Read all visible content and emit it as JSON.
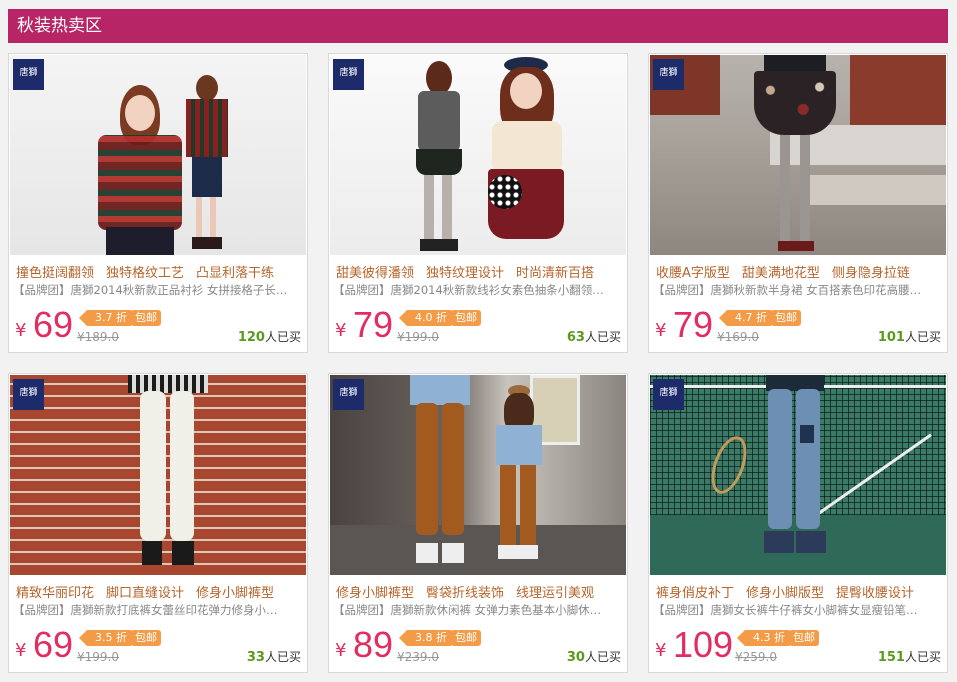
{
  "section_title": "秋装热卖区",
  "brand_mark": "唐獅",
  "currency": "¥",
  "discount_suffix": "折",
  "free_shipping": "包邮",
  "sold_suffix": "人已买",
  "colors": {
    "header": "#b72567",
    "price": "#e32c5f",
    "tag": "#b6642b",
    "badge": "#f49b47",
    "sold_count": "#5a9a1e"
  },
  "products": [
    {
      "tags": [
        "撞色挺阔翻领",
        "独特格纹工艺",
        "凸显利落干练"
      ],
      "desc": "【品牌团】唐獅2014秋新款正品衬衫 女拼接格子长…",
      "price": "69",
      "discount": "3.7",
      "original": "¥189.0",
      "sold": "120"
    },
    {
      "tags": [
        "甜美彼得潘领",
        "独特纹理设计",
        "时尚清新百搭"
      ],
      "desc": "【品牌团】唐獅2014秋新款线衫女素色抽条小翻领…",
      "price": "79",
      "discount": "4.0",
      "original": "¥199.0",
      "sold": "63"
    },
    {
      "tags": [
        "收腰A字版型",
        "甜美满地花型",
        "侧身隐身拉链"
      ],
      "desc": "【品牌团】唐獅秋新款半身裙 女百搭素色印花高腰…",
      "price": "79",
      "discount": "4.7",
      "original": "¥169.0",
      "sold": "101"
    },
    {
      "tags": [
        "精致华丽印花",
        "脚口直缝设计",
        "修身小脚裤型"
      ],
      "desc": "【品牌团】唐獅新款打底裤女蕾丝印花弹力修身小…",
      "price": "69",
      "discount": "3.5",
      "original": "¥199.0",
      "sold": "33"
    },
    {
      "tags": [
        "修身小脚裤型",
        "臀袋折线装饰",
        "线理运引美观"
      ],
      "desc": "【品牌团】唐獅新款休闲裤 女弹力素色基本小脚休…",
      "price": "89",
      "discount": "3.8",
      "original": "¥239.0",
      "sold": "30"
    },
    {
      "tags": [
        "裤身俏皮补丁",
        "修身小脚版型",
        "提臀收腰设计"
      ],
      "desc": "【品牌团】唐獅女长裤牛仔裤女小脚裤女显瘦铅笔…",
      "price": "109",
      "discount": "4.3",
      "original": "¥259.0",
      "sold": "151"
    }
  ]
}
